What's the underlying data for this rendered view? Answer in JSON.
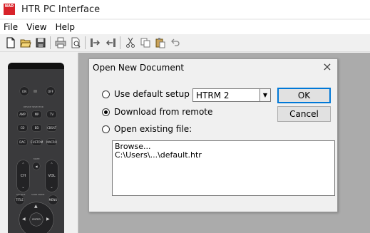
{
  "titlebar": {
    "logo_text": "NAD",
    "title": "HTR PC Interface"
  },
  "menubar": {
    "items": [
      "File",
      "View",
      "Help"
    ]
  },
  "toolbar": {
    "buttons": [
      "new-doc-icon",
      "open-folder-icon",
      "save-icon",
      "print-icon",
      "print-preview-icon",
      "send-to-device-icon",
      "receive-from-device-icon",
      "cut-icon",
      "copy-icon",
      "paste-icon",
      "undo-icon"
    ]
  },
  "remote": {
    "on": "ON",
    "off": "OFF",
    "device_selector": "DEVICE SELECTOR",
    "row1": [
      "AMP",
      "MP",
      "TV"
    ],
    "row2": [
      "CD",
      "BD",
      "CBSAT"
    ],
    "row3": [
      "DAC",
      "CUSTOM",
      "MACRO"
    ],
    "mute": "MUTE",
    "ch": "CH",
    "vol": "VOL",
    "source": "SOURCE",
    "surr_mode": "SURR MODE",
    "title": "TITLE",
    "menu": "MENU",
    "enter": "ENTER"
  },
  "dialog": {
    "title": "Open New Document",
    "close": "×",
    "options": [
      {
        "label": "Use default setup",
        "checked": false
      },
      {
        "label": "Download from remote",
        "checked": true
      },
      {
        "label": "Open existing file:",
        "checked": false
      }
    ],
    "select_value": "HTRM 2",
    "ok_label": "OK",
    "cancel_label": "Cancel",
    "files": [
      "Browse...",
      "C:\\Users\\...\\default.htr"
    ]
  }
}
